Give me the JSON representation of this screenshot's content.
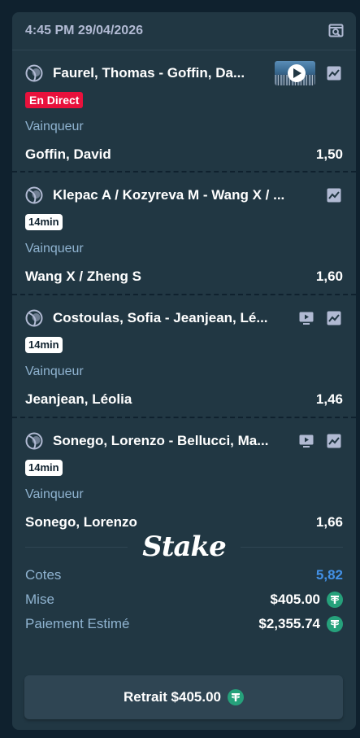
{
  "header": {
    "timestamp": "4:45 PM 29/04/2026"
  },
  "legs": [
    {
      "event": "Faurel, Thomas - Goffin, Da...",
      "status": "En Direct",
      "market": "Vainqueur",
      "selection": "Goffin, David",
      "odds": "1,50"
    },
    {
      "event": "Klepac A / Kozyreva M - Wang X / ...",
      "status": "14min",
      "market": "Vainqueur",
      "selection": "Wang X / Zheng S",
      "odds": "1,60"
    },
    {
      "event": "Costoulas, Sofia - Jeanjean, Lé...",
      "status": "14min",
      "market": "Vainqueur",
      "selection": "Jeanjean, Léolia",
      "odds": "1,46"
    },
    {
      "event": "Sonego, Lorenzo - Bellucci, Ma...",
      "status": "14min",
      "market": "Vainqueur",
      "selection": "Sonego, Lorenzo",
      "odds": "1,66"
    }
  ],
  "brand": {
    "logo_text": "Stake"
  },
  "summary": {
    "odds_label": "Cotes",
    "odds_value": "5,82",
    "stake_label": "Mise",
    "stake_value": "$405.00",
    "payout_label": "Paiement Estimé",
    "payout_value": "$2,355.74"
  },
  "cashout": {
    "label": "Retrait $405.00"
  },
  "icons": {
    "sport": "tennis-ball-icon",
    "stats": "trending-chart-icon",
    "stream": "tv-play-icon",
    "search": "search-icon",
    "currency": "tether-icon"
  },
  "colors": {
    "live": "#e9113c",
    "accent_odds": "#4391e7",
    "tether": "#26a17b"
  }
}
